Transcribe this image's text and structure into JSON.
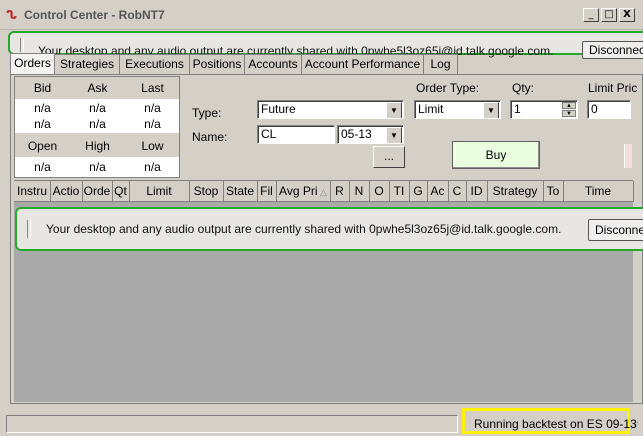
{
  "window": {
    "title": "Control Center - RobNT7",
    "minimize": "_",
    "maximize": "□",
    "close": "X"
  },
  "share_notice": {
    "text": "Your desktop and any audio output are currently shared with 0pwhe5l3oz65j@id.talk.google.com.",
    "button": "Disconnect"
  },
  "tabs": [
    "Orders",
    "Strategies",
    "Executions",
    "Positions",
    "Accounts",
    "Account Performance",
    "Log"
  ],
  "quote": {
    "headers1": [
      "Bid",
      "Ask",
      "Last"
    ],
    "row1": [
      "n/a",
      "n/a",
      "n/a"
    ],
    "row2": [
      "n/a",
      "n/a",
      "n/a"
    ],
    "headers2": [
      "Open",
      "High",
      "Low"
    ],
    "row3": [
      "n/a",
      "n/a",
      "n/a"
    ]
  },
  "order_form": {
    "type_label": "Type:",
    "type_value": "Future",
    "name_label": "Name:",
    "name_value": "CL",
    "expiry_value": "05-13",
    "browse_label": "...",
    "order_type_label": "Order Type:",
    "order_type_value": "Limit",
    "qty_label": "Qty:",
    "qty_value": "1",
    "limit_price_label": "Limit Pric",
    "limit_price_value": "0",
    "buy_label": "Buy"
  },
  "grid_columns": [
    "Instru",
    "Actio",
    "Orde",
    "Qt",
    "Limit",
    "Stop",
    "State",
    "Fil",
    "Avg Pri",
    "R",
    "N",
    "O",
    "TI",
    "G",
    "Ac",
    "C",
    "ID",
    "Strategy",
    "To",
    "Time"
  ],
  "status": {
    "text": "Running backtest on ES 09-13"
  },
  "colors": {
    "share_border": "#26a82a",
    "status_highlight": "#fff200",
    "buy_button": "#e9ffe0"
  }
}
